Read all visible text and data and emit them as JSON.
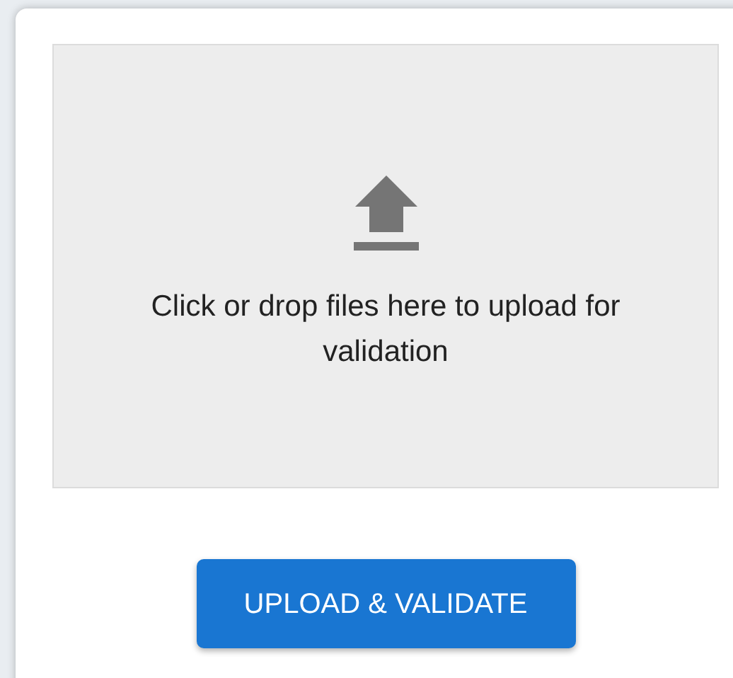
{
  "dropzone": {
    "prompt": "Click or drop files here to upload for validation"
  },
  "button": {
    "label": "UPLOAD & VALIDATE"
  }
}
